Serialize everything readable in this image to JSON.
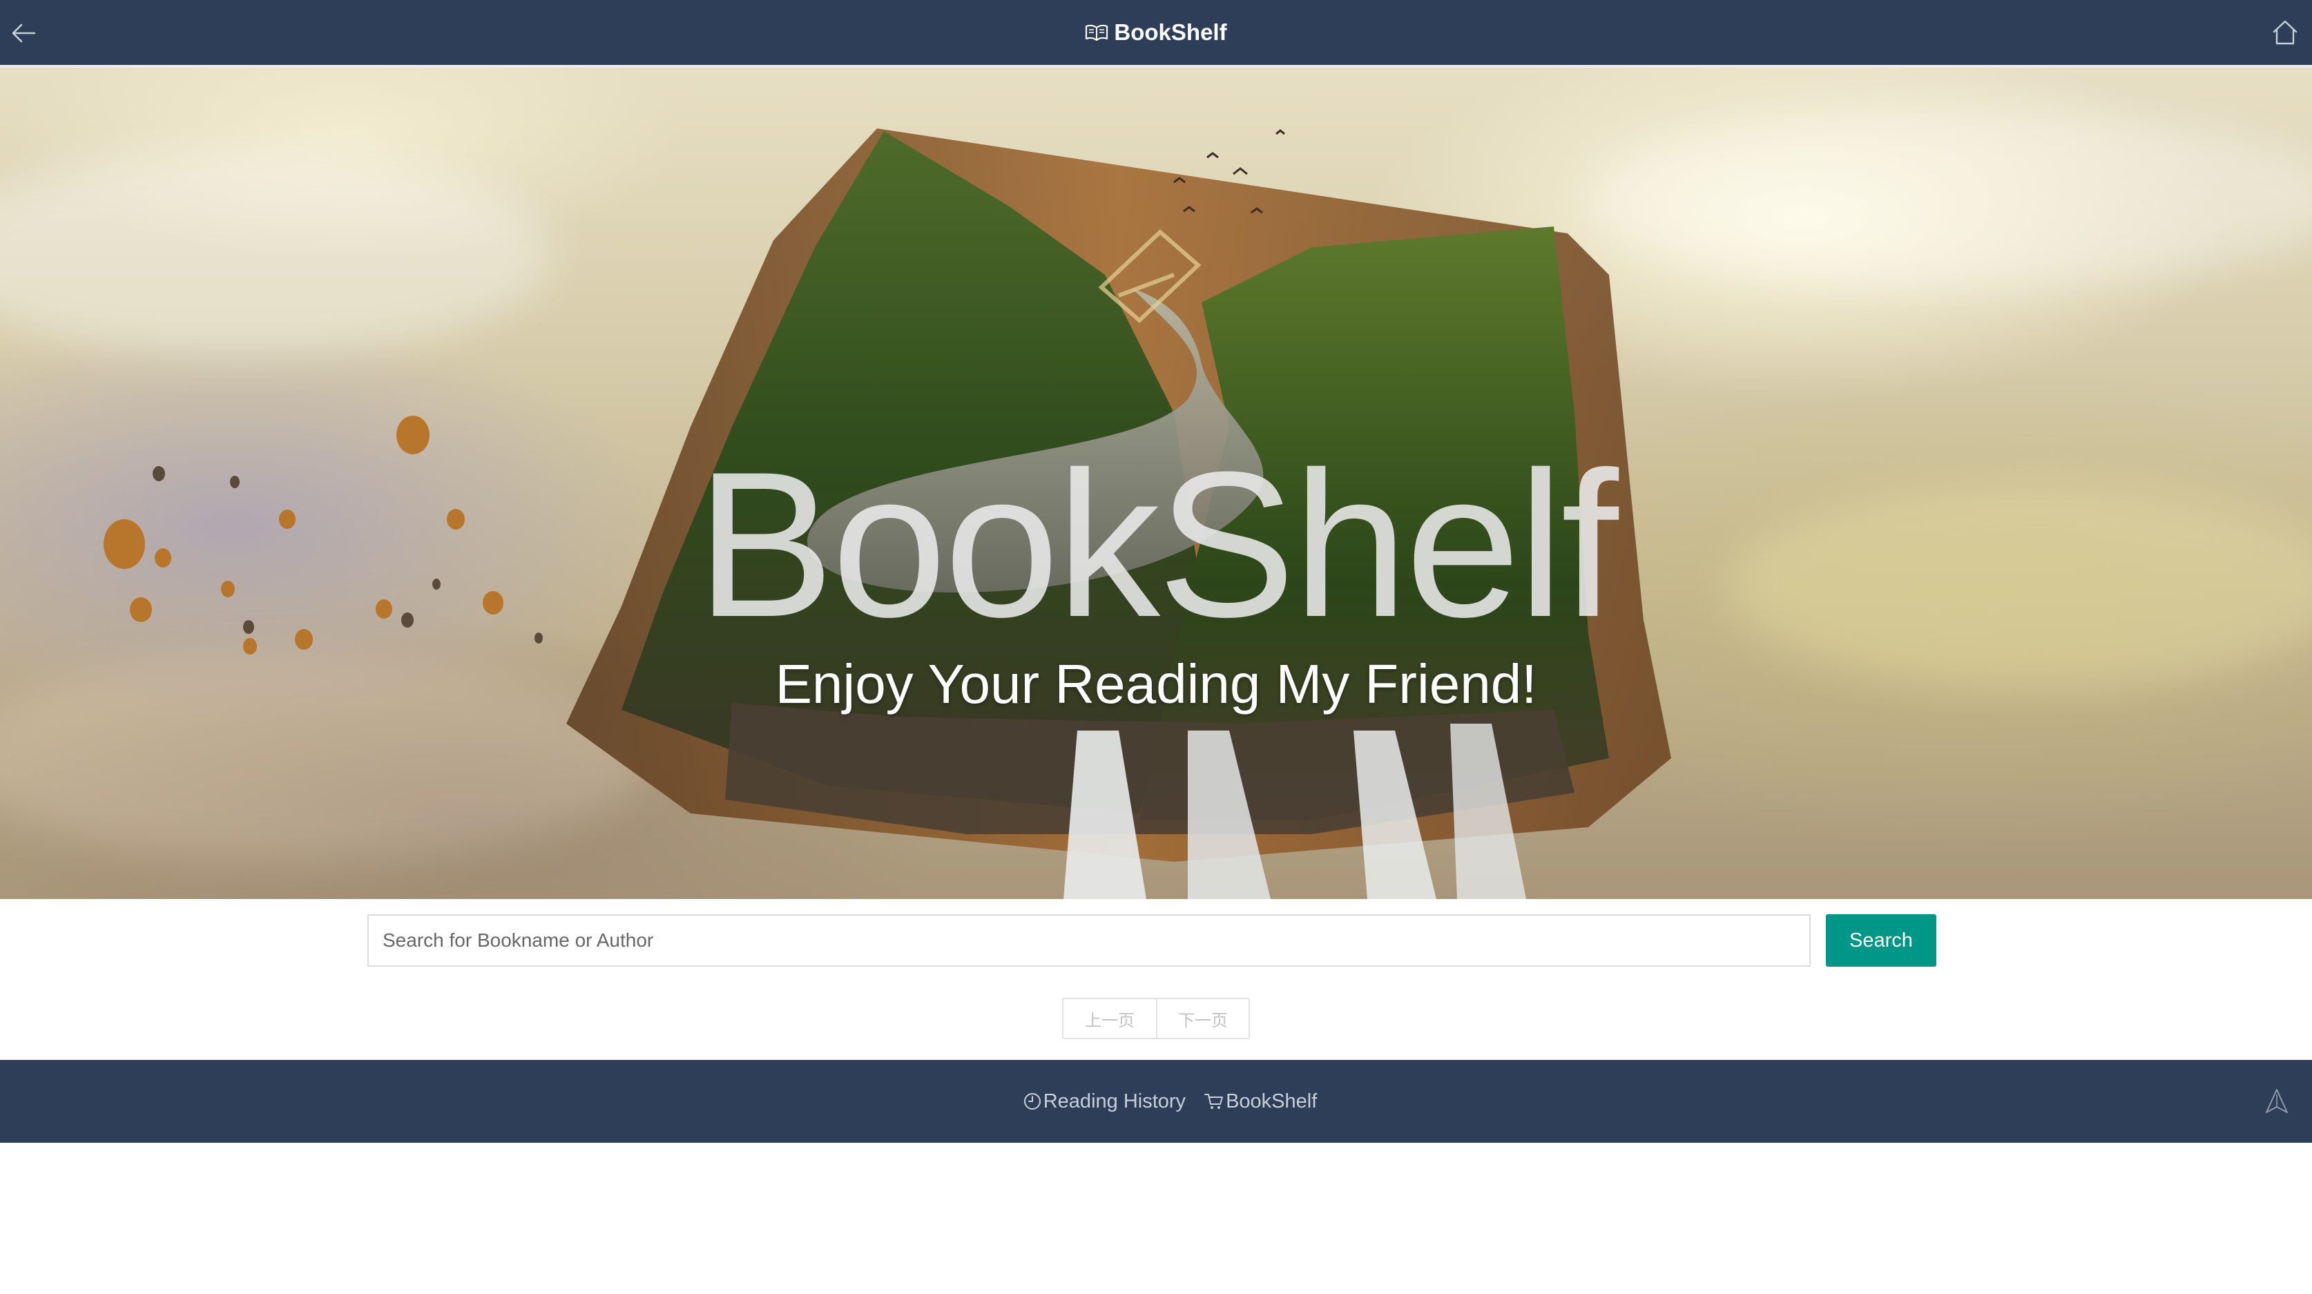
{
  "header": {
    "title": "BookShelf",
    "back_icon": "arrow-left-icon",
    "brand_icon": "open-book-icon",
    "home_icon": "home-icon",
    "background_color": "#2e3e58"
  },
  "hero": {
    "title": "BookShelf",
    "subtitle": "Enjoy Your Reading My Friend!"
  },
  "search": {
    "placeholder": "Search for Bookname or Author",
    "value": "",
    "button_label": "Search",
    "button_color": "#009688"
  },
  "pager": {
    "prev_label": "上一页",
    "next_label": "下一页"
  },
  "footer": {
    "history_label": "Reading History",
    "history_icon": "clock-icon",
    "bookshelf_label": "BookShelf",
    "bookshelf_icon": "cart-icon",
    "top_icon": "rocket-top-icon",
    "background_color": "#2e3e58"
  }
}
